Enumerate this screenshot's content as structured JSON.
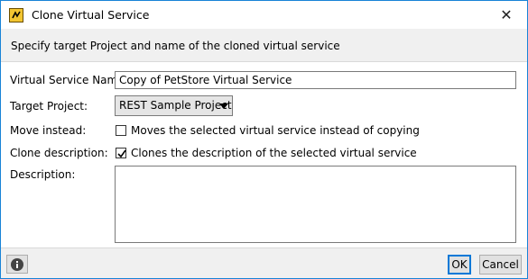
{
  "window": {
    "title": "Clone Virtual Service",
    "close_glyph": "✕"
  },
  "header": {
    "text": "Specify target Project and name of the cloned virtual service"
  },
  "form": {
    "name_label": "Virtual Service Name:",
    "name_value": "Copy of PetStore Virtual Service",
    "project_label": "Target Project:",
    "project_value": "REST Sample Project",
    "move_label": "Move instead:",
    "move_checkbox_label": "Moves the selected virtual service instead of copying",
    "move_checked": false,
    "clone_desc_label": "Clone description:",
    "clone_desc_checkbox_label": "Clones the description of the selected virtual service",
    "clone_desc_checked": true,
    "description_label": "Description:",
    "description_value": ""
  },
  "footer": {
    "ok_label": "OK",
    "cancel_label": "Cancel",
    "info_icon": "info-icon"
  },
  "colors": {
    "accent": "#0078d7",
    "window_border": "#1883d7"
  }
}
